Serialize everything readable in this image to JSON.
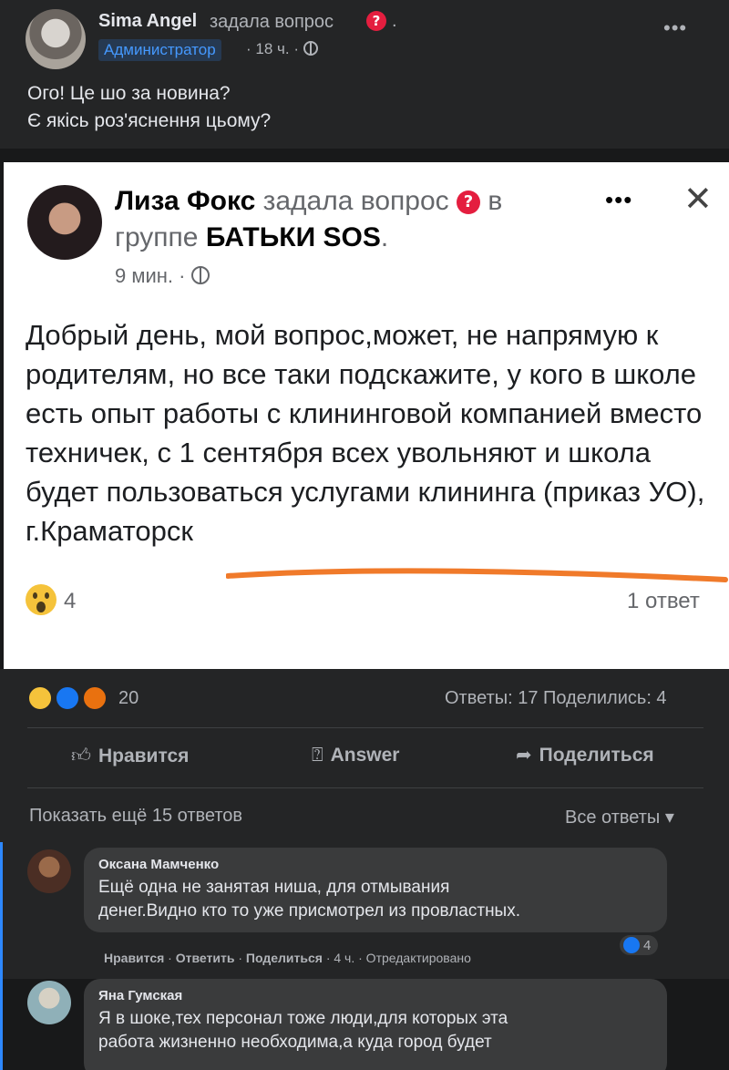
{
  "top_post": {
    "author": "Sima Angel",
    "action": "задала вопрос",
    "question_mark": "?",
    "dot": ".",
    "role": "Администратор",
    "time": "· 18 ч. ·",
    "more": "•••",
    "text_line1": "Ого! Це шо за новина?",
    "text_line2": "Є якісь роз'яснення цьому?"
  },
  "shared_post": {
    "author": "Лиза Фокс",
    "action": "задала вопрос",
    "question_mark": "?",
    "in": "в",
    "group_prefix": "группе",
    "group": "БАТЬКИ SOS",
    "group_suffix": ".",
    "time": "9 мин. ·",
    "more": "•••",
    "close": "✕",
    "body": "Добрый день, мой вопрос,может, не напрямую к родителям, но все таки подскажите, у кого в школе есть опыт работы с клининговой компанией вместо техничек, с 1 сентября всех увольняют и школа будет пользоваться услугами клининга (приказ УО), г.Краматорск",
    "reaction_count": "4",
    "answers": "1 ответ"
  },
  "stats": {
    "reactions_count": "20",
    "answers_shares": "Ответы: 17  Поделились: 4"
  },
  "actions": {
    "like": "Нравится",
    "answer": "Answer",
    "share": "Поделиться"
  },
  "comments_header": {
    "show_more": "Показать ещё 15 ответов",
    "all_answers": "Все ответы ▾"
  },
  "comments": [
    {
      "name": "Оксана Мамченко",
      "text_line1": "Ещё одна не занятая ниша, для отмывания",
      "text_line2": "денег.Видно кто то уже присмотрел из провластных.",
      "likes": "4",
      "meta_like": "Нравится",
      "meta_reply": "Ответить",
      "meta_share": "Поделиться",
      "meta_rest": "· 4 ч. · Отредактировано"
    },
    {
      "name": "Яна Гумская",
      "text_line1": "Я в шоке,тех персонал тоже люди,для которых эта",
      "text_line2": "работа жизненно необходима,а куда город будет"
    }
  ],
  "colors": {
    "accent": "#2d88ff",
    "question_badge": "#e41e3f",
    "underline": "#f07a2a"
  }
}
